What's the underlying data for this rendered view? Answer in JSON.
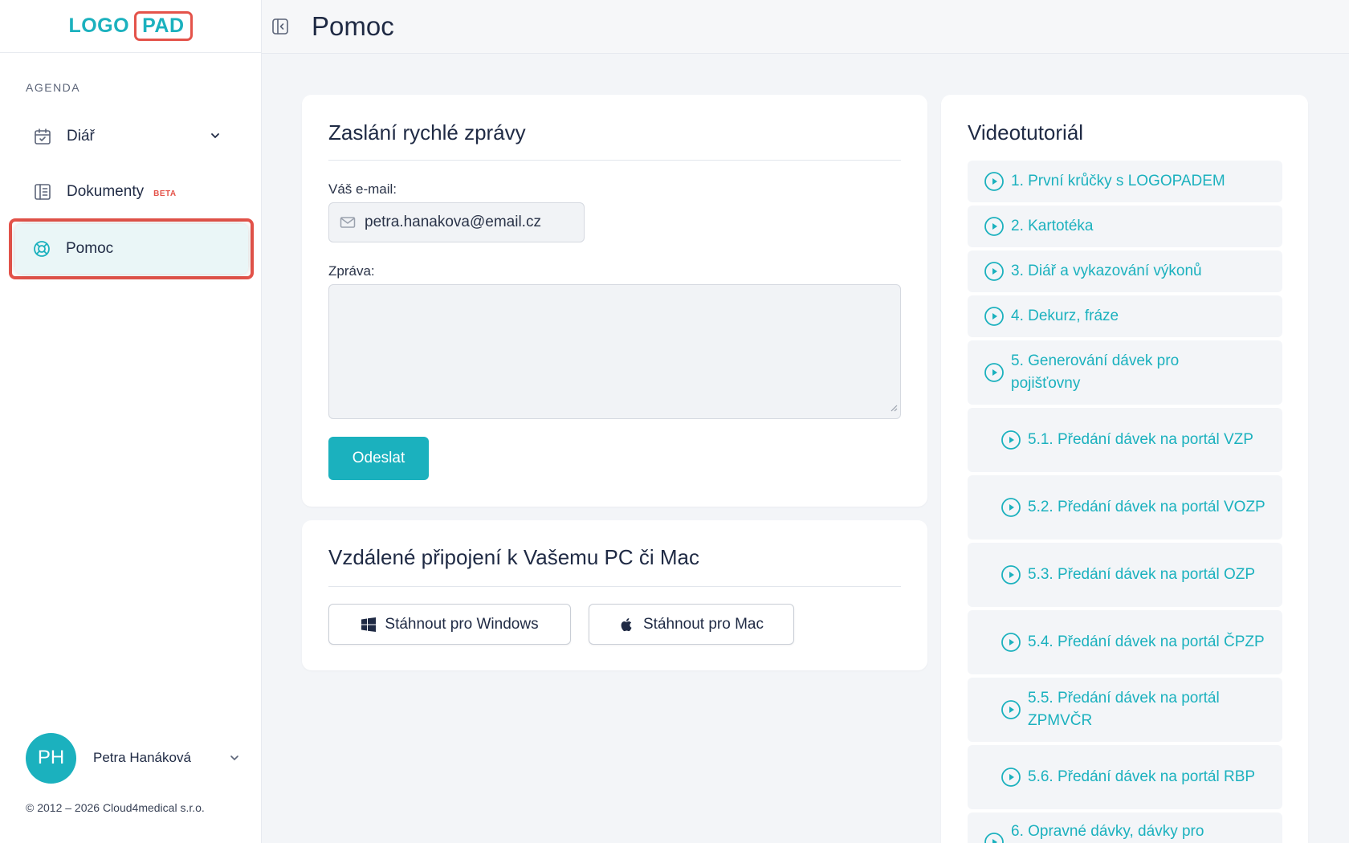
{
  "app": {
    "logo_left": "LOGO",
    "logo_right": "PAD",
    "brand_color": "#1bb1be",
    "highlight_color": "#e4534a"
  },
  "sidebar": {
    "section_label": "AGENDA",
    "items": [
      {
        "label": "Diář",
        "icon": "calendar-check-icon",
        "has_dropdown": true
      },
      {
        "label": "Dokumenty",
        "icon": "document-icon",
        "badge": "BETA"
      },
      {
        "label": "Pomoc",
        "icon": "lifebuoy-icon",
        "active": true
      }
    ],
    "user": {
      "initials": "PH",
      "name": "Petra Hanáková"
    },
    "copyright": "© 2012 – 2026 Cloud4medical s.r.o."
  },
  "header": {
    "title": "Pomoc"
  },
  "quick_message": {
    "title": "Zaslání rychlé zprávy",
    "email_label": "Váš e-mail:",
    "email_value": "petra.hanakova@email.cz",
    "message_label": "Zpráva:",
    "message_value": "",
    "send_label": "Odeslat"
  },
  "remote": {
    "title": "Vzdálené připojení k Vašemu PC či Mac",
    "windows_label": "Stáhnout pro Windows",
    "mac_label": "Stáhnout pro Mac"
  },
  "videos": {
    "title": "Videotutoriál",
    "items": [
      {
        "label": "1. První krůčky s LOGOPADEM"
      },
      {
        "label": "2. Kartotéka"
      },
      {
        "label": "3. Diář a vykazování výkonů"
      },
      {
        "label": "4. Dekurz, fráze"
      },
      {
        "label": "5. Generování dávek pro pojišťovny"
      },
      {
        "label": "5.1. Předání dávek na portál VZP"
      },
      {
        "label": "5.2. Předání dávek na portál VOZP"
      },
      {
        "label": "5.3. Předání dávek na portál OZP"
      },
      {
        "label": "5.4. Předání dávek na portál ČPZP"
      },
      {
        "label": "5.5. Předání dávek na portál ZPMVČR"
      },
      {
        "label": "5.6. Předání dávek na portál RBP"
      },
      {
        "label": "6. Opravné dávky, dávky pro"
      }
    ]
  }
}
